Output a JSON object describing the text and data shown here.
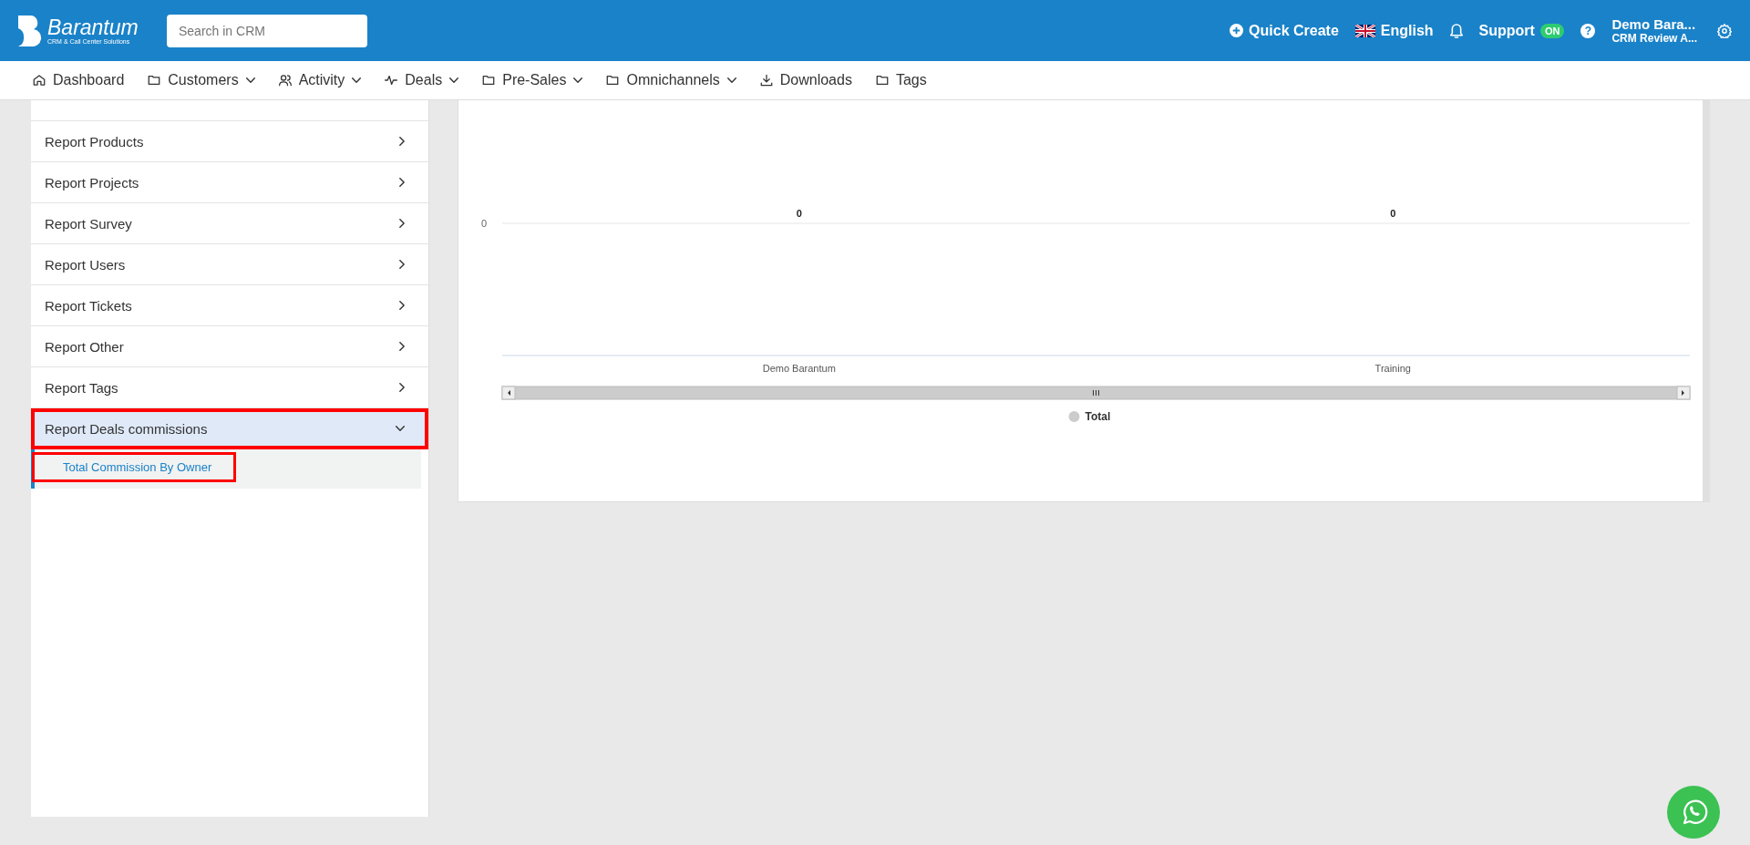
{
  "header": {
    "logo": {
      "name": "Barantum",
      "tagline": "CRM & Call Center Solutions"
    },
    "search": {
      "placeholder": "Search in CRM"
    },
    "quick_create": "Quick Create",
    "language": "English",
    "support": {
      "label": "Support",
      "badge": "ON"
    },
    "help": "?",
    "user": {
      "name": "Demo Bara...",
      "company": "CRM Review A..."
    }
  },
  "nav": [
    {
      "label": "Dashboard",
      "kind": "home",
      "has_menu": false
    },
    {
      "label": "Customers",
      "kind": "folder",
      "has_menu": true
    },
    {
      "label": "Activity",
      "kind": "users",
      "has_menu": true
    },
    {
      "label": "Deals",
      "kind": "pulse",
      "has_menu": true
    },
    {
      "label": "Pre-Sales",
      "kind": "folder",
      "has_menu": true
    },
    {
      "label": "Omnichannels",
      "kind": "folder",
      "has_menu": true
    },
    {
      "label": "Downloads",
      "kind": "download",
      "has_menu": false
    },
    {
      "label": "Tags",
      "kind": "folder",
      "has_menu": false
    }
  ],
  "sidebar": {
    "items": [
      {
        "label": "Report Products",
        "expanded": false,
        "highlighted": false
      },
      {
        "label": "Report Projects",
        "expanded": false,
        "highlighted": false
      },
      {
        "label": "Report Survey",
        "expanded": false,
        "highlighted": false
      },
      {
        "label": "Report Users",
        "expanded": false,
        "highlighted": false
      },
      {
        "label": "Report Tickets",
        "expanded": false,
        "highlighted": false
      },
      {
        "label": "Report Other",
        "expanded": false,
        "highlighted": false
      },
      {
        "label": "Report Tags",
        "expanded": false,
        "highlighted": false
      },
      {
        "label": "Report Deals commissions",
        "expanded": true,
        "highlighted": true,
        "children": [
          {
            "label": "Total Commission By Owner",
            "selected": true,
            "highlighted": true
          }
        ]
      }
    ]
  },
  "chart": {
    "y_axis_tick": "0",
    "value_labels": [
      "0",
      "0"
    ],
    "categories": [
      "Demo Barantum",
      "Training"
    ],
    "legend": [
      {
        "name": "Total",
        "color": "#cccccc"
      }
    ]
  }
}
